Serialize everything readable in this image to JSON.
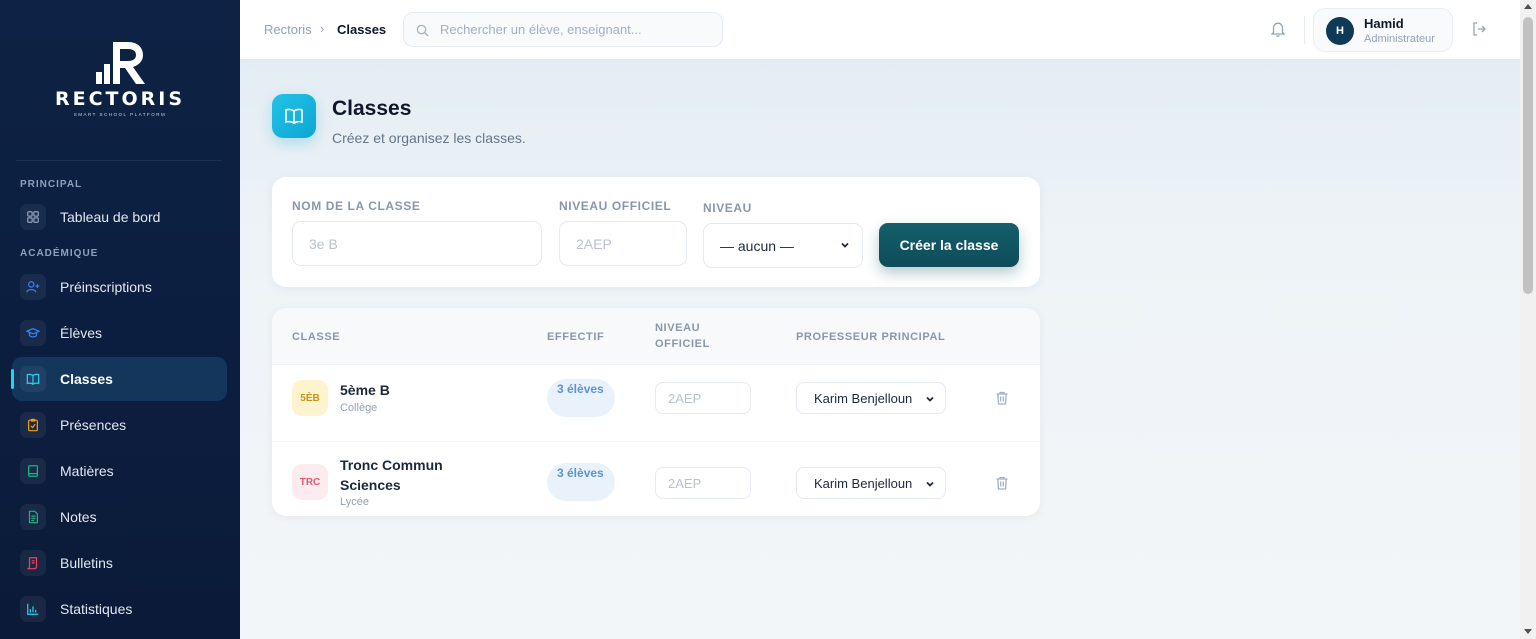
{
  "app": {
    "logo_text": "RECTORIS",
    "logo_tagline": "SMART SCHOOL PLATFORM"
  },
  "sidebar": {
    "sections": [
      "PRINCIPAL",
      "ACADÉMIQUE"
    ],
    "items": [
      {
        "label": "Tableau de bord",
        "icon": "dashboard-icon",
        "color": "#8ea0bb"
      },
      {
        "label": "Préinscriptions",
        "icon": "user-plus-icon",
        "color": "#3b82f6"
      },
      {
        "label": "Élèves",
        "icon": "graduation-cap-icon",
        "color": "#3b82f6"
      },
      {
        "label": "Classes",
        "icon": "book-open-icon",
        "color": "#22d3ee",
        "active": true
      },
      {
        "label": "Présences",
        "icon": "clipboard-check-icon",
        "color": "#f59e0b"
      },
      {
        "label": "Matières",
        "icon": "book-icon",
        "color": "#10b981"
      },
      {
        "label": "Notes",
        "icon": "file-text-icon",
        "color": "#10b981"
      },
      {
        "label": "Bulletins",
        "icon": "scroll-icon",
        "color": "#f43f5e"
      },
      {
        "label": "Statistiques",
        "icon": "bar-chart-icon",
        "color": "#22d3ee"
      }
    ]
  },
  "topbar": {
    "breadcrumb": [
      "Rectoris",
      "Classes"
    ],
    "search_placeholder": "Rechercher un élève, enseignant...",
    "user": {
      "initial": "H",
      "name": "Hamid",
      "role": "Administrateur"
    }
  },
  "page": {
    "title": "Classes",
    "subtitle": "Créez et organisez les classes."
  },
  "form": {
    "name_label": "NOM DE LA CLASSE",
    "name_placeholder": "3e B",
    "level_official_label": "NIVEAU OFFICIEL",
    "level_official_placeholder": "2AEP",
    "level_label": "NIVEAU",
    "level_selected": "— aucun —",
    "submit_label": "Créer la classe"
  },
  "table": {
    "headers": [
      "CLASSE",
      "EFFECTIF",
      "NIVEAU OFFICIEL",
      "PROFESSEUR PRINCIPAL"
    ],
    "rows": [
      {
        "badge": "5ÈB",
        "badge_bg": "#fdf3cf",
        "badge_color": "#c99414",
        "name": "5ème B",
        "cycle": "Collège",
        "effectif": "3 élèves",
        "level_placeholder": "2AEP",
        "teacher": "Karim Benjelloun"
      },
      {
        "badge": "TRC",
        "badge_bg": "#fdecef",
        "badge_color": "#e05a73",
        "name": "Tronc Commun Sciences",
        "cycle": "Lycée",
        "effectif": "3 élèves",
        "level_placeholder": "2AEP",
        "teacher": "Karim Benjelloun"
      }
    ]
  },
  "colors": {
    "accent": "#0e4d5a",
    "sidebar_bg": "#0c1e3f",
    "active_item": "#22d3ee"
  }
}
